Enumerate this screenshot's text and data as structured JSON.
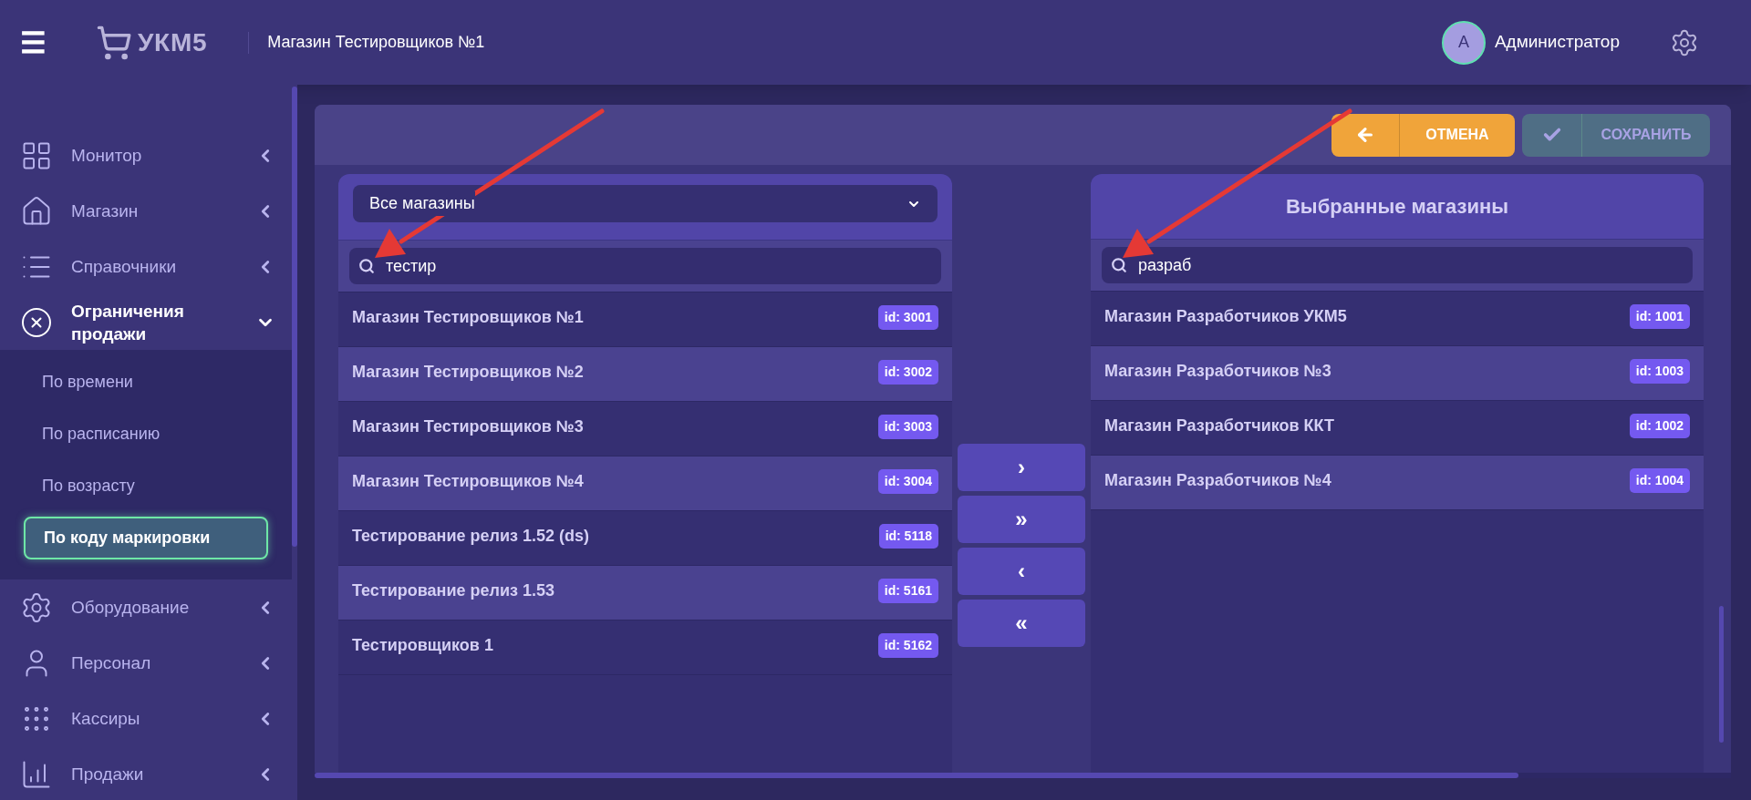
{
  "header": {
    "menu_icon": "☰",
    "logo_text": "УКМ5",
    "store_name": "Магазин Тестировщиков №1",
    "avatar_letter": "А",
    "user_name": "Администратор"
  },
  "sidebar": {
    "items": [
      {
        "label": "Монитор",
        "expanded": false
      },
      {
        "label": "Магазин",
        "expanded": false
      },
      {
        "label": "Справочники",
        "expanded": false
      },
      {
        "label": "Ограничения продажи",
        "expanded": true,
        "children": [
          {
            "label": "По времени",
            "selected": false
          },
          {
            "label": "По расписанию",
            "selected": false
          },
          {
            "label": "По возрасту",
            "selected": false
          },
          {
            "label": "По коду маркировки",
            "selected": true
          }
        ]
      },
      {
        "label": "Оборудование",
        "expanded": false
      },
      {
        "label": "Персонал",
        "expanded": false
      },
      {
        "label": "Кассиры",
        "expanded": false
      },
      {
        "label": "Продажи",
        "expanded": false
      }
    ]
  },
  "toolbar": {
    "cancel": {
      "label": "ОТМЕНА",
      "disabled": false
    },
    "save": {
      "label": "СОХРАНИТЬ",
      "disabled": true
    }
  },
  "left_panel": {
    "filter": "Все магазины",
    "search": "тестир",
    "rows": [
      {
        "name": "Магазин Тестировщиков №1",
        "id": "id: 3001"
      },
      {
        "name": "Магазин Тестировщиков №2",
        "id": "id: 3002"
      },
      {
        "name": "Магазин Тестировщиков №3",
        "id": "id: 3003"
      },
      {
        "name": "Магазин Тестировщиков №4",
        "id": "id: 3004"
      },
      {
        "name": "Тестирование релиз 1.52 (ds)",
        "id": "id: 5118"
      },
      {
        "name": "Тестирование релиз 1.53",
        "id": "id: 5161"
      },
      {
        "name": "Тестировщиков 1",
        "id": "id: 5162"
      }
    ]
  },
  "transfer_buttons": [
    "›",
    "»",
    "‹",
    "«"
  ],
  "right_panel": {
    "title": "Выбранные магазины",
    "search": "разраб",
    "rows": [
      {
        "name": "Магазин Разработчиков УКМ5",
        "id": "id: 1001"
      },
      {
        "name": "Магазин Разработчиков №3",
        "id": "id: 1003"
      },
      {
        "name": "Магазин Разработчиков ККТ",
        "id": "id: 1002"
      },
      {
        "name": "Магазин Разработчиков №4",
        "id": "id: 1004"
      }
    ]
  }
}
